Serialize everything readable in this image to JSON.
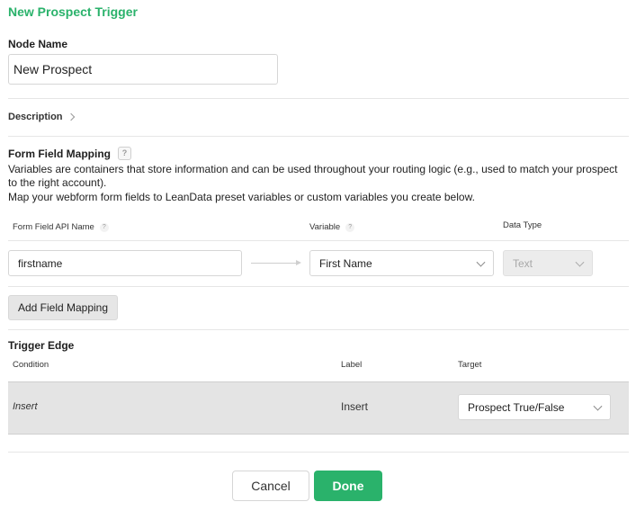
{
  "header": {
    "title": "New Prospect Trigger"
  },
  "node_name": {
    "label": "Node Name",
    "value": "New Prospect"
  },
  "description": {
    "label": "Description"
  },
  "form_field_mapping": {
    "title": "Form Field Mapping",
    "help": "?",
    "paragraph_line1": "Variables are containers that store information and can be used throughout your routing logic (e.g., used to match your prospect",
    "paragraph_line2": "to the right account).",
    "paragraph_line3": "Map your webform form fields to LeanData preset variables or custom variables you create below.",
    "columns": {
      "api_name": "Form Field API Name",
      "variable": "Variable",
      "data_type": "Data Type"
    },
    "row": {
      "api_name_value": "firstname",
      "variable_value": "First Name",
      "data_type_value": "Text"
    },
    "add_button": "Add Field Mapping"
  },
  "trigger_edge": {
    "title": "Trigger Edge",
    "columns": {
      "condition": "Condition",
      "label": "Label",
      "target": "Target"
    },
    "row": {
      "condition": "Insert",
      "label": "Insert",
      "target": "Prospect True/False"
    }
  },
  "footer": {
    "cancel": "Cancel",
    "done": "Done"
  },
  "colors": {
    "accent": "#2ab26b",
    "row_bg": "#e4e4e4",
    "button_gray": "#e6e6e6"
  },
  "icons": [
    "help-icon",
    "chevron-right-icon",
    "chevron-down-icon",
    "arrow-right-icon"
  ]
}
